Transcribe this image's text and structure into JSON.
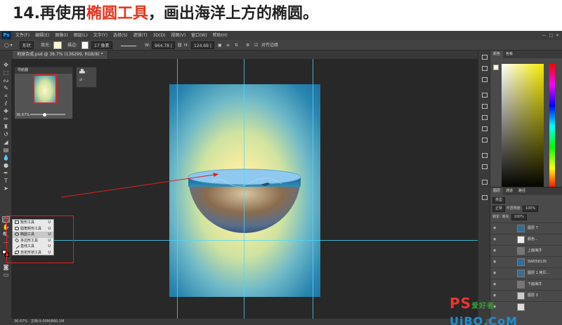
{
  "heading": {
    "prefix": "14.再使用",
    "tool": "椭圆工具",
    "suffix": "，画出海洋上方的椭圆。"
  },
  "app": {
    "logo": "Ps"
  },
  "menu": [
    "文件(F)",
    "编辑(E)",
    "图像(I)",
    "图层(L)",
    "文字(Y)",
    "选择(S)",
    "滤镜(T)",
    "3D(D)",
    "视图(V)",
    "窗口(W)",
    "帮助(H)"
  ],
  "options": {
    "mode": "形状",
    "fill_label": "填充:",
    "stroke_label": "描边:",
    "stroke_width": "17 像素",
    "w_label": "W:",
    "w_value": "964.78 |",
    "h_label": "H:",
    "h_value": "124.69 |",
    "align_edges": "对齐边缘"
  },
  "doc_tab": "地球合成.psd @ 36.7% (136299, RGB/8) *",
  "navigator": {
    "title": "导航器",
    "zoom": "36.67%"
  },
  "flyout": {
    "items": [
      {
        "label": "矩形工具",
        "key": "U"
      },
      {
        "label": "圆角矩形工具",
        "key": "U"
      },
      {
        "label": "椭圆工具",
        "key": "U"
      },
      {
        "label": "多边形工具",
        "key": "U"
      },
      {
        "label": "直线工具",
        "key": "U"
      },
      {
        "label": "自定形状工具",
        "key": "U"
      }
    ]
  },
  "color_panel": {
    "tab1": "颜色",
    "tab2": "色板"
  },
  "layers_panel": {
    "tab1": "图层",
    "tab2": "通道",
    "tab3": "路径",
    "kind": "类型",
    "blend": "正常",
    "opacity_label": "不透明度:",
    "opacity": "100%",
    "lock_label": "锁定:",
    "fill_label": "填充:",
    "fill": "100%",
    "layers": [
      "图层 7",
      "颜色...",
      "上面海洋",
      "SW058135",
      "图层 1 拷贝...",
      "下面海洋",
      "图层 3",
      ""
    ]
  },
  "status": {
    "zoom": "36.67%",
    "doc": "文档:9.00M/860.1M"
  },
  "watermark": {
    "a": "PS",
    "b": "爱好者",
    "c": "UiBQ.CoM"
  }
}
